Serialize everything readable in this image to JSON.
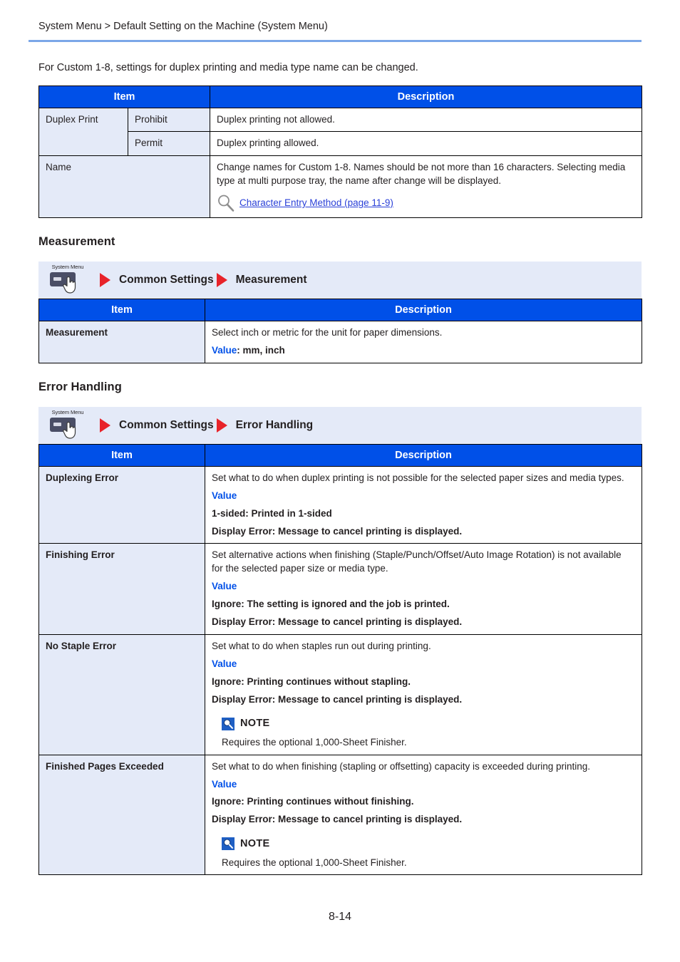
{
  "header": {
    "breadcrumb": "System Menu > Default Setting on the Machine (System Menu)"
  },
  "intro": {
    "paragraph": "For Custom 1-8, settings for duplex printing and media type name can be changed."
  },
  "common": {
    "col_item": "Item",
    "col_description": "Description",
    "value_label": "Value",
    "note_title": "NOTE",
    "icon_sysmenu_label": "System Menu",
    "icon_magnifier": "magnifier-icon",
    "icon_note": "note-magnifier-icon",
    "icon_arrow": "red-triangle-right-icon"
  },
  "colors": {
    "table_header_blue": "#0050e8",
    "item_cell_fill": "#e4eaf8",
    "nav_strip_fill": "#e4eaf8",
    "accent_blue": "#0050e8",
    "link_blue": "#2b41d8",
    "arrow_red": "#e8232a",
    "header_rule_blue": "#7ba7e8"
  },
  "custom_table": {
    "rows": [
      {
        "item": "Duplex Print",
        "sub": "Prohibit",
        "description": "Duplex printing not allowed."
      },
      {
        "item": "",
        "sub": "Permit",
        "description": "Duplex printing allowed."
      },
      {
        "item": "Name",
        "sub": "",
        "description": "Change names for Custom 1-8. Names should be not more than 16 characters. Selecting media type at multi purpose tray, the name after change will be displayed.",
        "link": "Character Entry Method (page 11-9)"
      }
    ]
  },
  "measurement_section": {
    "title": "Measurement",
    "nav": {
      "step1": "Common Settings",
      "step2": "Measurement"
    },
    "row": {
      "item": "Measurement",
      "desc_line1": "Select inch or metric for the unit for paper dimensions.",
      "value_suffix": ": mm, inch"
    }
  },
  "error_handling_section": {
    "title": "Error Handling",
    "nav": {
      "step1": "Common Settings",
      "step2": "Error Handling"
    },
    "rows": [
      {
        "item": "Duplexing Error",
        "desc": "Set what to do when duplex printing is not possible for the selected paper sizes and media types.",
        "opt1": "1-sided: Printed in 1-sided",
        "opt2": "Display Error: Message to cancel printing is displayed.",
        "note": null
      },
      {
        "item": "Finishing Error",
        "desc": "Set alternative actions when finishing (Staple/Punch/Offset/Auto Image Rotation) is not available for the selected paper size or media type.",
        "opt1": "Ignore: The setting is ignored and the job is printed.",
        "opt2": "Display Error: Message to cancel printing is displayed.",
        "note": null
      },
      {
        "item": "No Staple Error",
        "desc": "Set what to do when staples run out during printing.",
        "opt1": "Ignore: Printing continues without stapling.",
        "opt2": "Display Error: Message to cancel printing is displayed.",
        "note": "Requires the optional 1,000-Sheet Finisher."
      },
      {
        "item": "Finished Pages Exceeded",
        "desc": "Set what to do when finishing (stapling or offsetting) capacity is exceeded during printing.",
        "opt1": "Ignore: Printing continues without finishing.",
        "opt2": "Display Error: Message to cancel printing is displayed.",
        "note": "Requires the optional 1,000-Sheet Finisher."
      }
    ]
  },
  "footer": {
    "page_number": "8-14"
  }
}
